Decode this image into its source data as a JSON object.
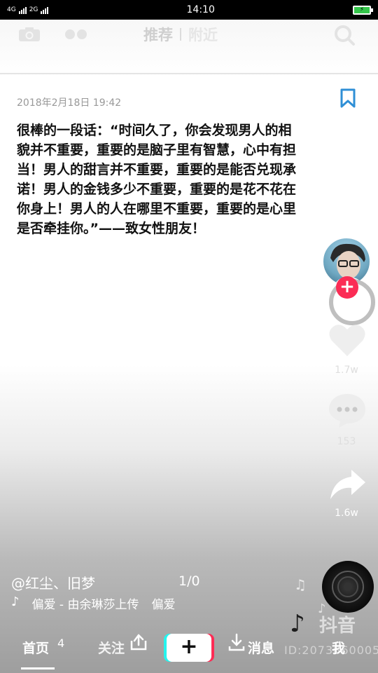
{
  "status_bar": {
    "network_left": "4G",
    "network_right": "2G",
    "time": "14:10"
  },
  "top_nav": {
    "tabs": [
      {
        "label": "推荐",
        "active": true
      },
      {
        "label": "附近",
        "active": false
      }
    ]
  },
  "post": {
    "date": "2018年2月18日 19:42",
    "body": "很棒的一段话：“时间久了，你会发现男人的相\n貌并不重要，重要的是脑子里有智慧，心中有担\n当！男人的甜言并不重要，重要的是能否兑现承\n诺！男人的金钱多少不重要，重要的是花不花在\n你身上！男人的人在哪里不重要，重要的是心里\n是否牵挂你。”——致女性朋友！"
  },
  "right_rail": {
    "follow_label": "+",
    "likes": "1.7w",
    "comments": "153",
    "shares": "1.6w"
  },
  "video_info": {
    "author": "@红尘、旧梦",
    "page_counter": "1/0",
    "music_title": "偏爱 - 由余琳莎上传",
    "music_scroll": "偏爱"
  },
  "watermark": {
    "text": "抖音",
    "id": "ID:2073860005"
  },
  "bottom_nav": {
    "home": "首页",
    "home_badge": "4",
    "follow": "关注",
    "create": "+",
    "messages": "消息",
    "me": "我"
  },
  "colors": {
    "accent_red": "#fb2c55",
    "accent_cyan": "#25f4ee",
    "bookmark_blue": "#2f8fd6",
    "battery_green": "#35c74b"
  }
}
